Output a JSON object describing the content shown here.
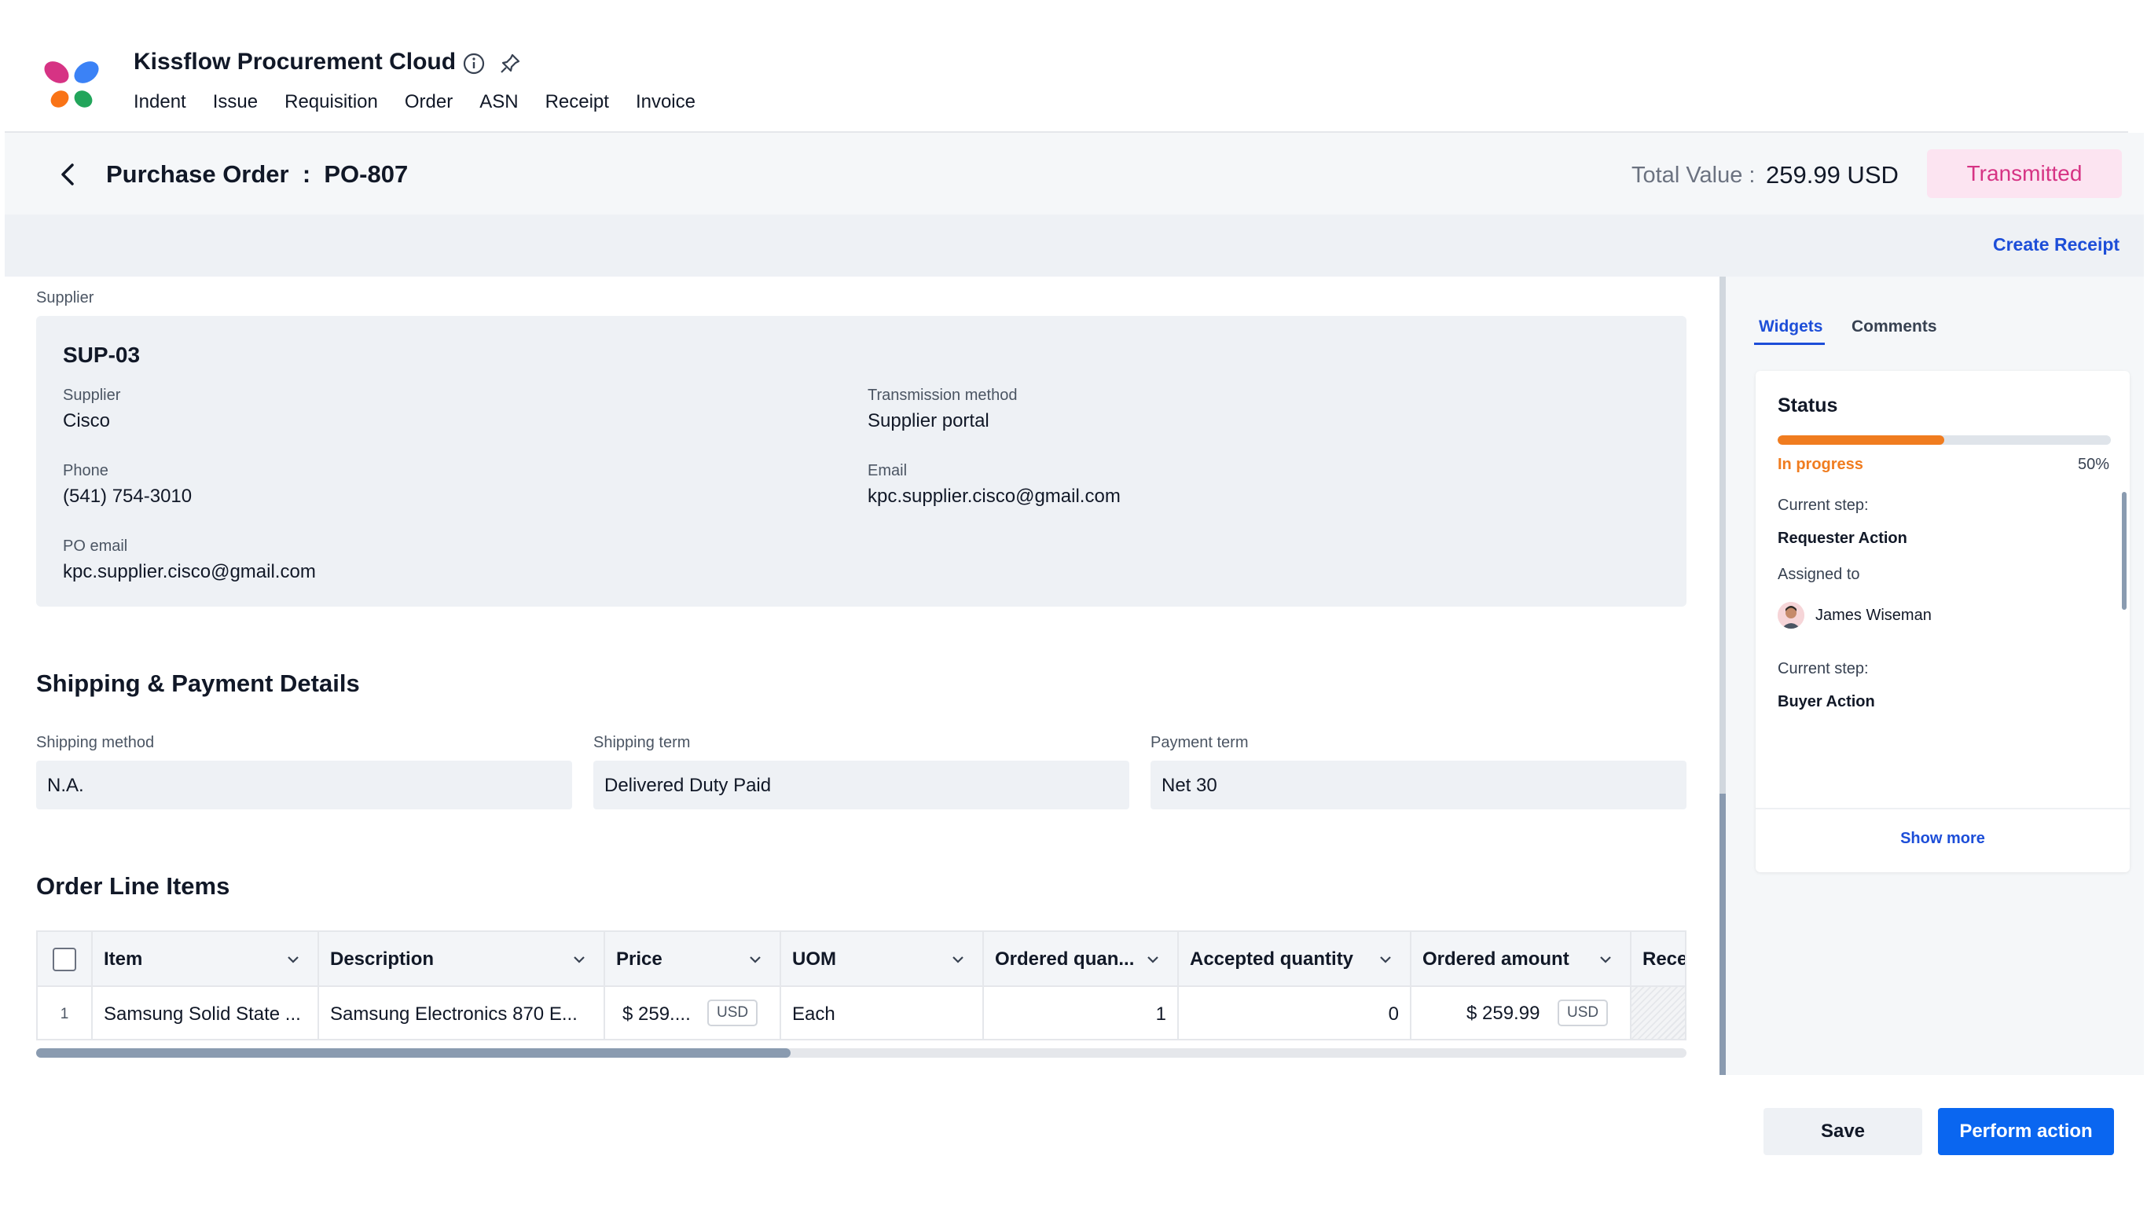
{
  "app": {
    "title": "Kissflow Procurement Cloud",
    "nav": [
      "Indent",
      "Issue",
      "Requisition",
      "Order",
      "ASN",
      "Receipt",
      "Invoice"
    ]
  },
  "page": {
    "title": "Purchase Order  :  PO-807",
    "total_label": "Total Value :",
    "total_value": "259.99 USD",
    "status": "Transmitted",
    "create_receipt": "Create Receipt"
  },
  "supplier": {
    "section_label": "Supplier",
    "code": "SUP-03",
    "fields": {
      "supplier_label": "Supplier",
      "supplier_value": "Cisco",
      "phone_label": "Phone",
      "phone_value": "(541) 754-3010",
      "po_email_label": "PO email",
      "po_email_value": "kpc.supplier.cisco@gmail.com",
      "transmission_label": "Transmission method",
      "transmission_value": "Supplier portal",
      "email_label": "Email",
      "email_value": "kpc.supplier.cisco@gmail.com"
    }
  },
  "shipping": {
    "heading": "Shipping & Payment Details",
    "method_label": "Shipping method",
    "method_value": "N.A.",
    "term_label": "Shipping term",
    "term_value": "Delivered Duty Paid",
    "payment_label": "Payment term",
    "payment_value": "Net 30"
  },
  "order_lines": {
    "heading": "Order Line Items",
    "columns": [
      "Item",
      "Description",
      "Price",
      "UOM",
      "Ordered quan...",
      "Accepted quantity",
      "Ordered amount",
      "Recei"
    ],
    "rows": [
      {
        "num": "1",
        "item": "Samsung Solid State ...",
        "description": "Samsung Electronics 870 E...",
        "price": "$ 259....",
        "price_currency": "USD",
        "uom": "Each",
        "ordered_qty": "1",
        "accepted_qty": "0",
        "ordered_amount": "$ 259.99",
        "amount_currency": "USD"
      }
    ]
  },
  "sidebar": {
    "tabs": [
      "Widgets",
      "Comments"
    ],
    "status": {
      "title": "Status",
      "progress": 0.5,
      "progress_label": "In progress",
      "progress_pct": "50%",
      "step1_label": "Current step:",
      "step1_value": "Requester Action",
      "assigned_label": "Assigned to",
      "assignee": "James Wiseman",
      "step2_label": "Current step:",
      "step2_value": "Buyer Action",
      "show_more": "Show more"
    }
  },
  "footer": {
    "save": "Save",
    "perform": "Perform action"
  },
  "colors": {
    "accent": "#0a66f0",
    "status_pill_bg": "#fce4f1",
    "status_pill_text": "#d63384",
    "progress": "#f07c1f"
  }
}
